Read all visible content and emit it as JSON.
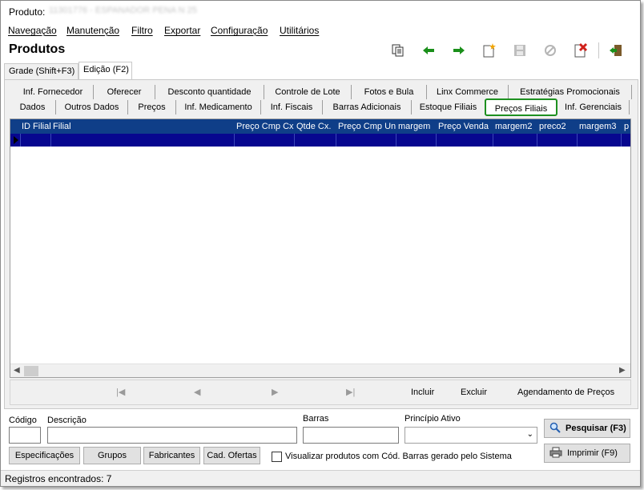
{
  "window": {
    "title_label": "Produto:",
    "title_value": "11301776 - ESPANADOR PENA N 25"
  },
  "menu": [
    "Navegação",
    "Manutenção",
    "Filtro",
    "Exportar",
    "Configuração",
    "Utilitários"
  ],
  "header": {
    "title": "Produtos"
  },
  "toolbar": {
    "icons": [
      "copy-icon",
      "arrow-left-icon",
      "arrow-right-icon",
      "new-icon",
      "save-icon",
      "cancel-icon",
      "delete-icon",
      "exit-icon"
    ]
  },
  "mode_tabs": [
    "Grade (Shift+F3)",
    "Edição (F2)"
  ],
  "tabs_row1": [
    "Inf. Fornecedor",
    "Oferecer",
    "Desconto quantidade",
    "Controle de Lote",
    "Fotos e Bula",
    "Linx Commerce",
    "Estratégias Promocionais"
  ],
  "tabs_row2": [
    "Dados",
    "Outros Dados",
    "Preços",
    "Inf. Medicamento",
    "Inf. Fiscais",
    "Barras Adicionais",
    "Estoque Filiais",
    "Preços Filiais",
    "Inf. Gerenciais"
  ],
  "grid": {
    "columns": [
      "ID Filial",
      "Filial",
      "Preço Cmp Cx",
      "Qtde Cx.",
      "Preço Cmp Un",
      "margem",
      "Preço Venda",
      "margem2",
      "preco2",
      "margem3",
      "p"
    ]
  },
  "navigator": {
    "include": "Incluir",
    "delete": "Excluir",
    "schedule": "Agendamento de Preços"
  },
  "search": {
    "code_label": "Código",
    "desc_label": "Descrição",
    "barcode_label": "Barras",
    "active_label": "Princípio Ativo",
    "search_button": "Pesquisar (F3)",
    "print_button": "Imprimir (F9)",
    "specs_button": "Especificações",
    "groups_button": "Grupos",
    "makers_button": "Fabricantes",
    "offers_button": "Cad. Ofertas",
    "checkbox_label": "Visualizar produtos com Cód. Barras gerado pelo Sistema"
  },
  "status": {
    "text": "Registros encontrados: 7"
  },
  "colors": {
    "grid_header": "#0f3e88",
    "grid_row": "#07078f",
    "selected_tab_border": "#1e9020"
  }
}
